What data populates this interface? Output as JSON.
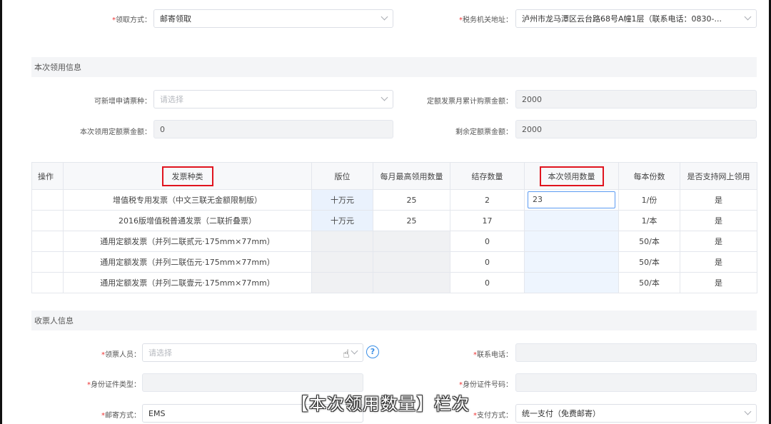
{
  "top": {
    "pickup_label": "领取方式：",
    "pickup_value": "邮寄领取",
    "tax_office_label": "税务机关地址：",
    "tax_office_value": "泸州市龙马潭区云台路68号A幢1层（联系电话：0830-..."
  },
  "section1": {
    "title": "本次领用信息",
    "new_type_label": "可新增申请票种：",
    "new_type_placeholder": "请选择",
    "monthly_total_label": "定额发票月累计购票金额：",
    "monthly_total_value": "2000",
    "current_amount_label": "本次领用定额票金额：",
    "current_amount_value": "0",
    "remaining_label": "剩余定额票金额：",
    "remaining_value": "2000"
  },
  "table": {
    "headers": [
      "操作",
      "发票种类",
      "版位",
      "每月最高领用数量",
      "结存数量",
      "本次领用数量",
      "每本份数",
      "是否支持网上领用"
    ],
    "rows": [
      {
        "type": "增值税专用发票（中文三联无金额限制版）",
        "edition": "十万元",
        "max": "25",
        "stock": "2",
        "qty": "23",
        "per": "1/份",
        "online": "是"
      },
      {
        "type": "2016版增值税普通发票（二联折叠票）",
        "edition": "十万元",
        "max": "25",
        "stock": "17",
        "qty": "",
        "per": "1/本",
        "online": "是"
      },
      {
        "type": "通用定额发票（并列二联贰元·175mm×77mm）",
        "edition": "",
        "max": "",
        "stock": "0",
        "qty": "",
        "per": "50/本",
        "online": "是"
      },
      {
        "type": "通用定额发票（并列二联伍元·175mm×77mm）",
        "edition": "",
        "max": "",
        "stock": "0",
        "qty": "",
        "per": "50/本",
        "online": "是"
      },
      {
        "type": "通用定额发票（并列二联壹元·175mm×77mm）",
        "edition": "",
        "max": "",
        "stock": "0",
        "qty": "",
        "per": "50/本",
        "online": "是"
      }
    ]
  },
  "section2": {
    "title": "收票人信息",
    "receiver_label": "领票人员：",
    "receiver_placeholder": "请选择",
    "phone_label": "联系电话：",
    "id_type_label": "身份证件类型：",
    "id_no_label": "身份证件号码：",
    "mail_label": "邮寄方式：",
    "mail_value": "EMS",
    "pay_label": "支付方式：",
    "pay_value": "统一支付（免费邮寄）"
  },
  "subtitle": "【本次领用数量】栏次",
  "colors": {
    "required": "#e33333",
    "highlight_box": "#e0141e",
    "input_focus": "#5b9bf2",
    "help": "#3a8ee6"
  }
}
